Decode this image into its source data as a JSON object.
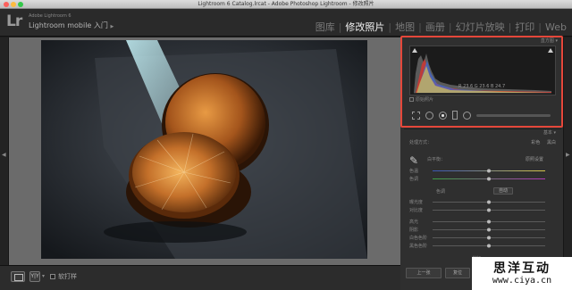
{
  "window": {
    "title": "Lightroom 6 Catalog.lrcat - Adobe Photoshop Lightroom - 修改照片"
  },
  "header": {
    "logo": "Lr",
    "subtitle_small": "Adobe Lightroom 6",
    "identity_plate": "Lightroom mobile 入门",
    "modules": [
      {
        "label": "图库",
        "active": false
      },
      {
        "label": "修改照片",
        "active": true
      },
      {
        "label": "地图",
        "active": false
      },
      {
        "label": "画册",
        "active": false
      },
      {
        "label": "幻灯片放映",
        "active": false
      },
      {
        "label": "打印",
        "active": false
      },
      {
        "label": "Web",
        "active": false
      }
    ],
    "separator": "|"
  },
  "toolbar": {
    "compare_label": "Y|Y",
    "soft_proof_label": "软打样"
  },
  "right_panel": {
    "histogram_title": "直方图",
    "histogram_readout": "R  23.6  G  23.6  B  24.7",
    "original_label": "原始照片",
    "basic_title": "基本",
    "treatment_label": "处理方式：",
    "color_label": "彩色",
    "bw_label": "黑白",
    "wb_label": "白平衡：",
    "wb_value": "原照设置",
    "temp_label": "色温",
    "tint_label": "色调",
    "tone_label": "色调",
    "auto_label": "自动",
    "exposure_label": "曝光度",
    "contrast_label": "对比度",
    "highlights_label": "高光",
    "shadows_label": "阴影",
    "whites_label": "白色色阶",
    "blacks_label": "黑色色阶",
    "presence_label": "偏好",
    "prev_button": "上一张",
    "reset_button": "复位"
  },
  "watermark": {
    "title": "思洋互动",
    "url": "www.ciya.cn"
  },
  "colors": {
    "highlight_border": "#e5473a",
    "active_module": "#f0f0f0",
    "inactive_module": "#7a7a7a"
  }
}
